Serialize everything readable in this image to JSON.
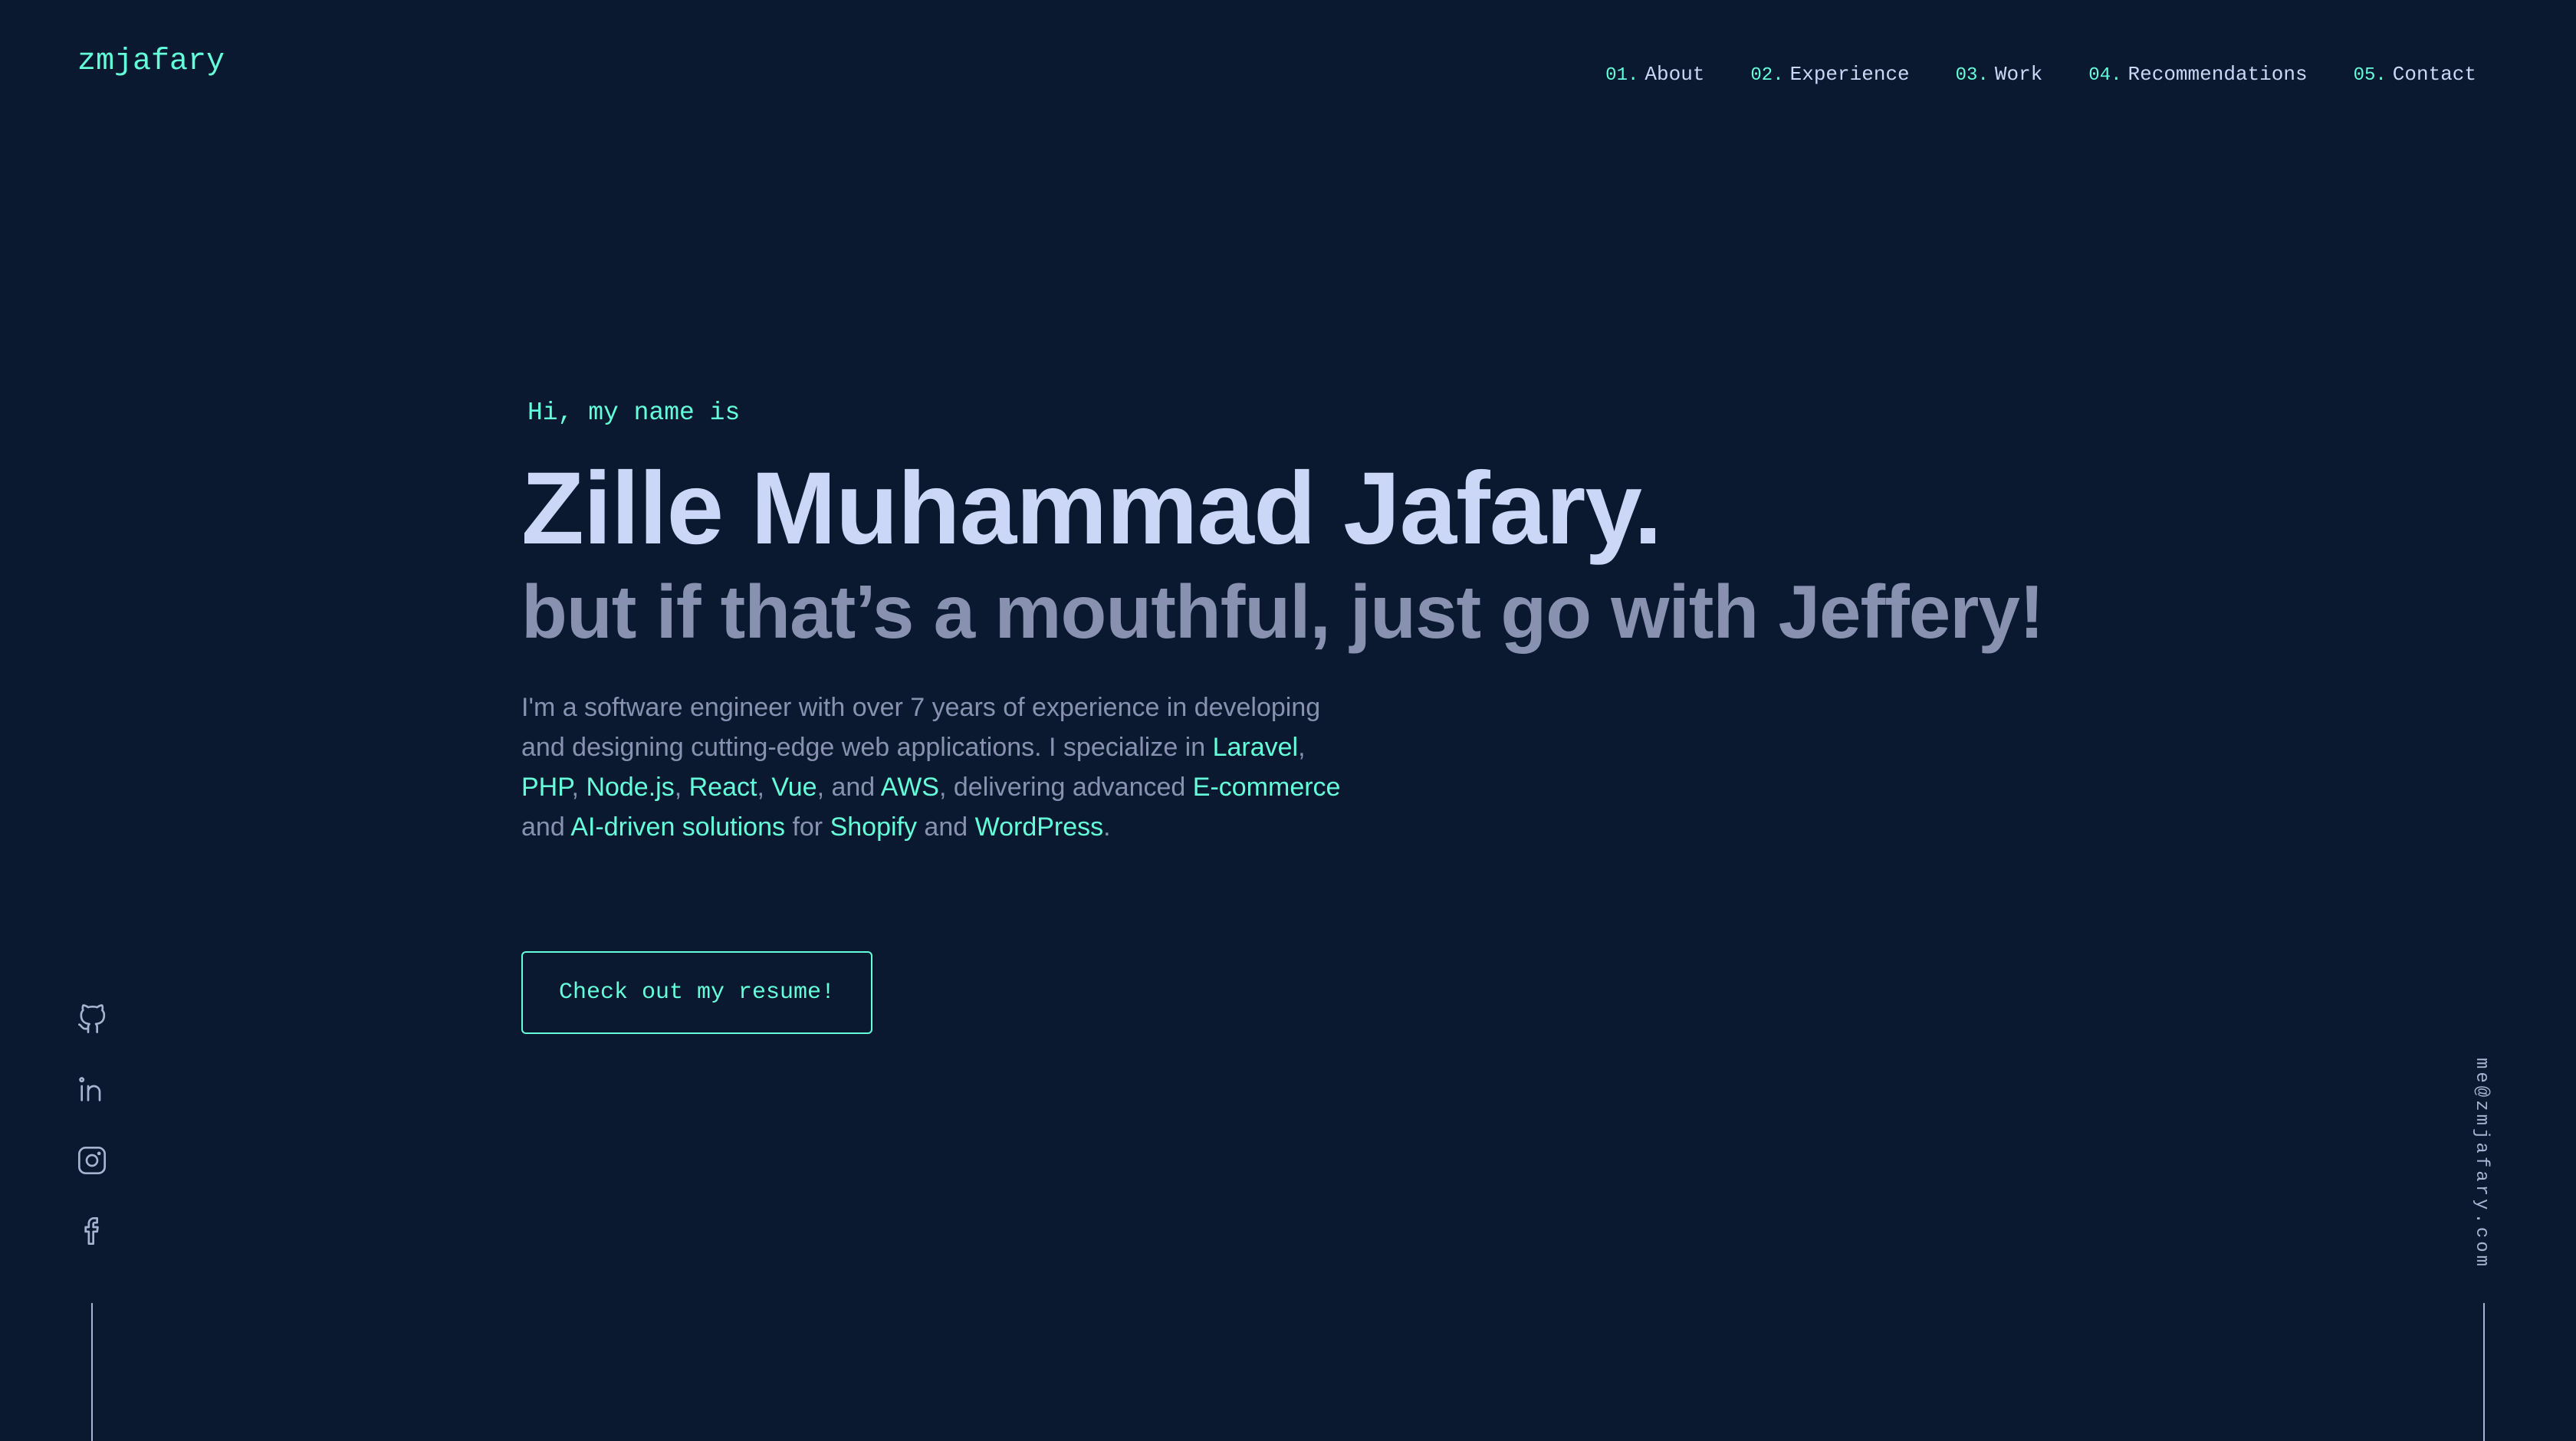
{
  "header": {
    "logo": "zmjafary",
    "nav": [
      {
        "num": "01.",
        "label": "About"
      },
      {
        "num": "02.",
        "label": "Experience"
      },
      {
        "num": "03.",
        "label": "Work"
      },
      {
        "num": "04.",
        "label": "Recommendations"
      },
      {
        "num": "05.",
        "label": "Contact"
      }
    ]
  },
  "hero": {
    "intro": "Hi, my name is",
    "name": "Zille Muhammad Jafary.",
    "tagline": "but if that’s a mouthful, just go with Jeffery!",
    "description": {
      "t1": "I'm a software engineer with over 7 years of experience in developing and designing cutting-edge web applications. I specialize in ",
      "laravel": "Laravel",
      "sep1": ", ",
      "php": "PHP",
      "sep2": ", ",
      "node": "Node.js",
      "sep3": ", ",
      "react": "React",
      "sep4": ", ",
      "vue": "Vue",
      "sep5": ", and ",
      "aws": "AWS",
      "t2": ", delivering advanced ",
      "ecommerce": "E-commerce",
      "t3": " and ",
      "ai": "AI-driven solutions",
      "t4": " for ",
      "shopify": "Shopify",
      "t5": " and ",
      "wordpress": "WordPress",
      "t6": "."
    },
    "resume_button": "Check out my resume!"
  },
  "socials": [
    "github-icon",
    "linkedin-icon",
    "instagram-icon",
    "facebook-icon"
  ],
  "email": "me@zmjafary.com",
  "colors": {
    "background": "#0a192f",
    "accent": "#64ffda",
    "heading": "#ccd6f6",
    "text": "#8892b0"
  }
}
